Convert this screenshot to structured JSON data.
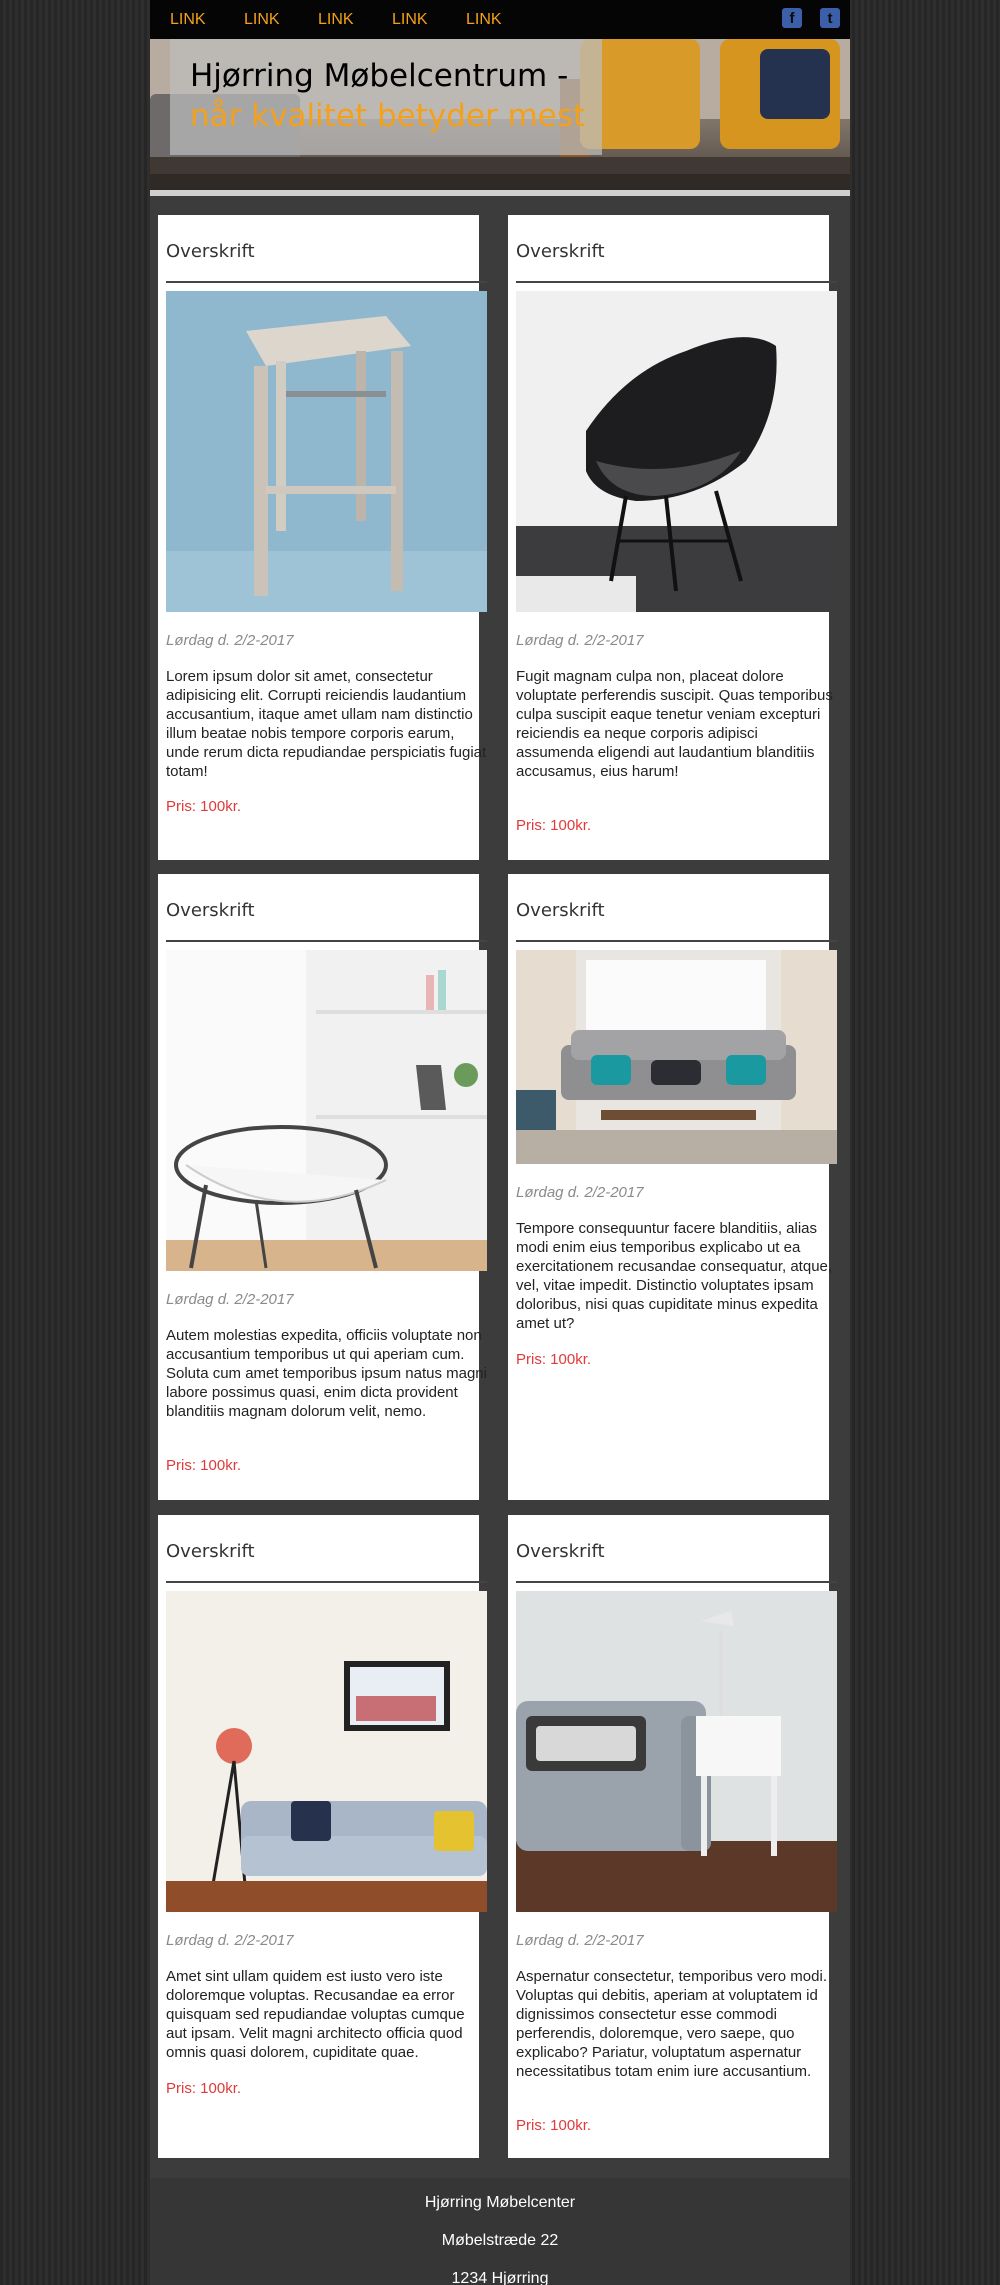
{
  "nav": {
    "links": [
      "LINK",
      "LINK",
      "LINK",
      "LINK",
      "LINK"
    ],
    "social": [
      {
        "icon": "facebook-icon",
        "glyph": "f"
      },
      {
        "icon": "twitter-icon",
        "glyph": "t"
      }
    ]
  },
  "hero": {
    "title_line1": "Hjørring Møbelcentrum -",
    "title_line2": "når kvalitet betyder mest"
  },
  "cards": [
    {
      "heading": "Overskrift",
      "image": "bar-stool-photo",
      "date": "Lørdag d. 2/2-2017",
      "text": "Lorem ipsum dolor sit amet, consectetur adipisicing elit. Corrupti reiciendis laudantium accusantium, itaque amet ullam nam distinctio illum beatae nobis tempore corporis earum, unde rerum dicta repudiandae perspiciatis fugiat totam!",
      "price": "Pris: 100kr."
    },
    {
      "heading": "Overskrift",
      "image": "black-armchair-photo",
      "date": "Lørdag d. 2/2-2017",
      "text": "Fugit magnam culpa non, placeat dolore voluptate perferendis suscipit. Quas temporibus culpa suscipit eaque tenetur veniam excepturi reiciendis ea neque corporis adipisci assumenda eligendi aut laudantium blanditiis accusamus, eius harum!",
      "price": "Pris: 100kr."
    },
    {
      "heading": "Overskrift",
      "image": "wire-chair-photo",
      "date": "Lørdag d. 2/2-2017",
      "text": "Autem molestias expedita, officiis voluptate non accusantium temporibus ut qui aperiam cum. Soluta cum amet temporibus ipsum natus magni labore possimus quasi, enim dicta provident blanditiis magnam dolorum velit, nemo.",
      "price": "Pris: 100kr."
    },
    {
      "heading": "Overskrift",
      "image": "living-room-sofa-photo",
      "date": "Lørdag d. 2/2-2017",
      "text": "Tempore consequuntur facere blanditiis, alias modi enim eius temporibus explicabo ut ea exercitationem recusandae consequatur, atque, vel, vitae impedit. Distinctio voluptates ipsam doloribus, nisi quas cupiditate minus expedita amet ut?",
      "price": "Pris: 100kr."
    },
    {
      "heading": "Overskrift",
      "image": "blue-sofa-photo",
      "date": "Lørdag d. 2/2-2017",
      "text": "Amet sint ullam quidem est iusto vero iste doloremque voluptas. Recusandae ea error quisquam sed repudiandae voluptas cumque aut ipsam. Velit magni architecto officia quod omnis quasi dolorem, cupiditate quae.",
      "price": "Pris: 100kr."
    },
    {
      "heading": "Overskrift",
      "image": "grey-sofa-lamp-photo",
      "date": "Lørdag d. 2/2-2017",
      "text": "Aspernatur consectetur, temporibus vero modi. Voluptas qui debitis, aperiam at voluptatem id dignissimos consectetur esse commodi perferendis, doloremque, vero saepe, quo explicabo? Pariatur, voluptatum aspernatur necessitatibus totam enim iure accusantium.",
      "price": "Pris: 100kr."
    }
  ],
  "footer": {
    "name": "Hjørring Møbelcenter",
    "street": "Møbelstræde 22",
    "city": "1234 Hjørring"
  },
  "colors": {
    "accent": "#f5a01b",
    "price": "#e03a3a",
    "nav_bg": "#050505",
    "social": "#3b5fa8"
  }
}
